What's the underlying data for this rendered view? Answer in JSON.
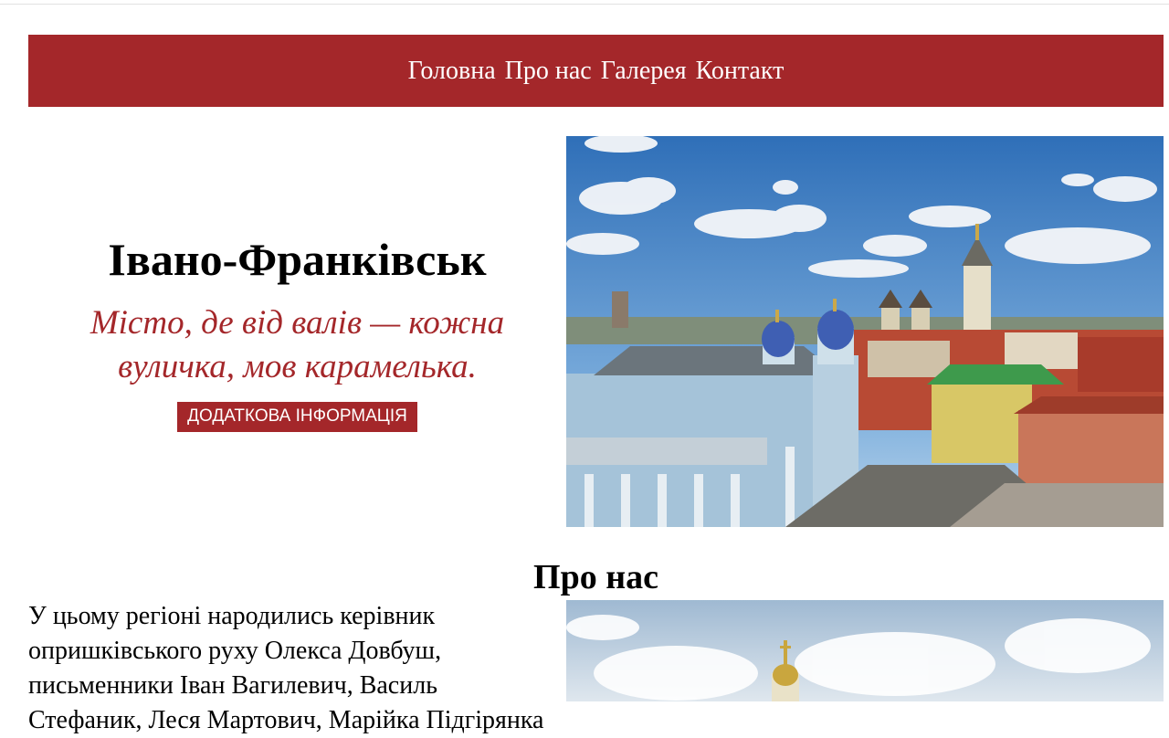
{
  "nav": {
    "items": [
      {
        "label": "Головна"
      },
      {
        "label": "Про нас"
      },
      {
        "label": "Галерея"
      },
      {
        "label": "Контакт"
      }
    ]
  },
  "hero": {
    "title": "Івано-Франківськ",
    "tagline": "Місто, де від валів — кожна вуличка, мов карамелька.",
    "button_label": "ДОДАТКОВА ІНФОРМАЦІЯ"
  },
  "about": {
    "heading": "Про нас",
    "text": "У цьому регіоні народились керівник опришківського руху Олекса Довбуш, письменники Іван Вагилевич, Василь Стефаник, Леся Мартович, Марійка Підгірянка"
  },
  "colors": {
    "accent": "#a4272a",
    "nav_text": "#ffffff"
  }
}
